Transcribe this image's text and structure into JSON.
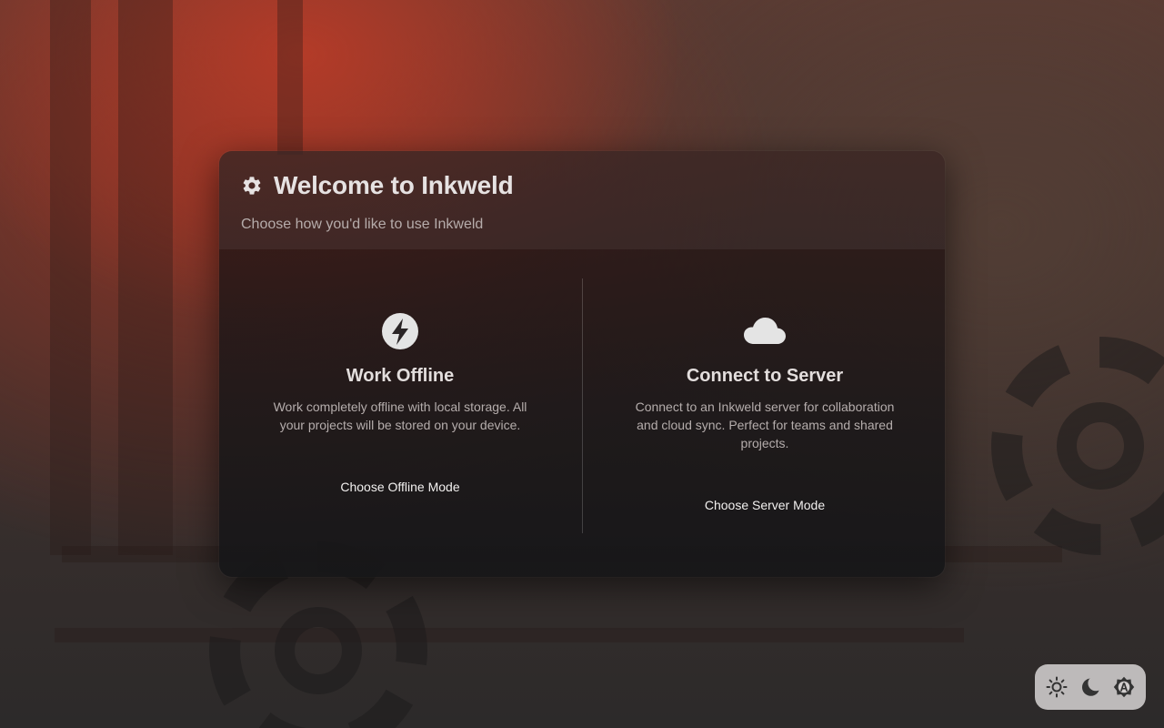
{
  "app": {
    "title": "Welcome to Inkweld",
    "subtitle": "Choose how you'd like to use Inkweld",
    "title_icon": "gear-icon"
  },
  "options": {
    "offline": {
      "icon": "lightning-bolt-icon",
      "title": "Work Offline",
      "description": "Work completely offline with local storage. All your projects will be stored on your device.",
      "button_label": "Choose Offline Mode"
    },
    "server": {
      "icon": "cloud-icon",
      "title": "Connect to Server",
      "description": "Connect to an Inkweld server for collaboration and cloud sync. Perfect for teams and shared projects.",
      "button_label": "Choose Server Mode"
    }
  },
  "theme_switcher": {
    "buttons": [
      {
        "icon": "sun-icon",
        "mode": "light"
      },
      {
        "icon": "moon-icon",
        "mode": "dark"
      },
      {
        "icon": "auto-theme-icon",
        "mode": "auto"
      }
    ]
  },
  "colors": {
    "dialog_bg": "#1e1b1c",
    "text_primary": "#e6e2e2",
    "text_secondary": "#b6acab",
    "switcher_bg": "#d2cece",
    "icon_light": "#e4e4e4",
    "icon_dark": "#333333"
  }
}
